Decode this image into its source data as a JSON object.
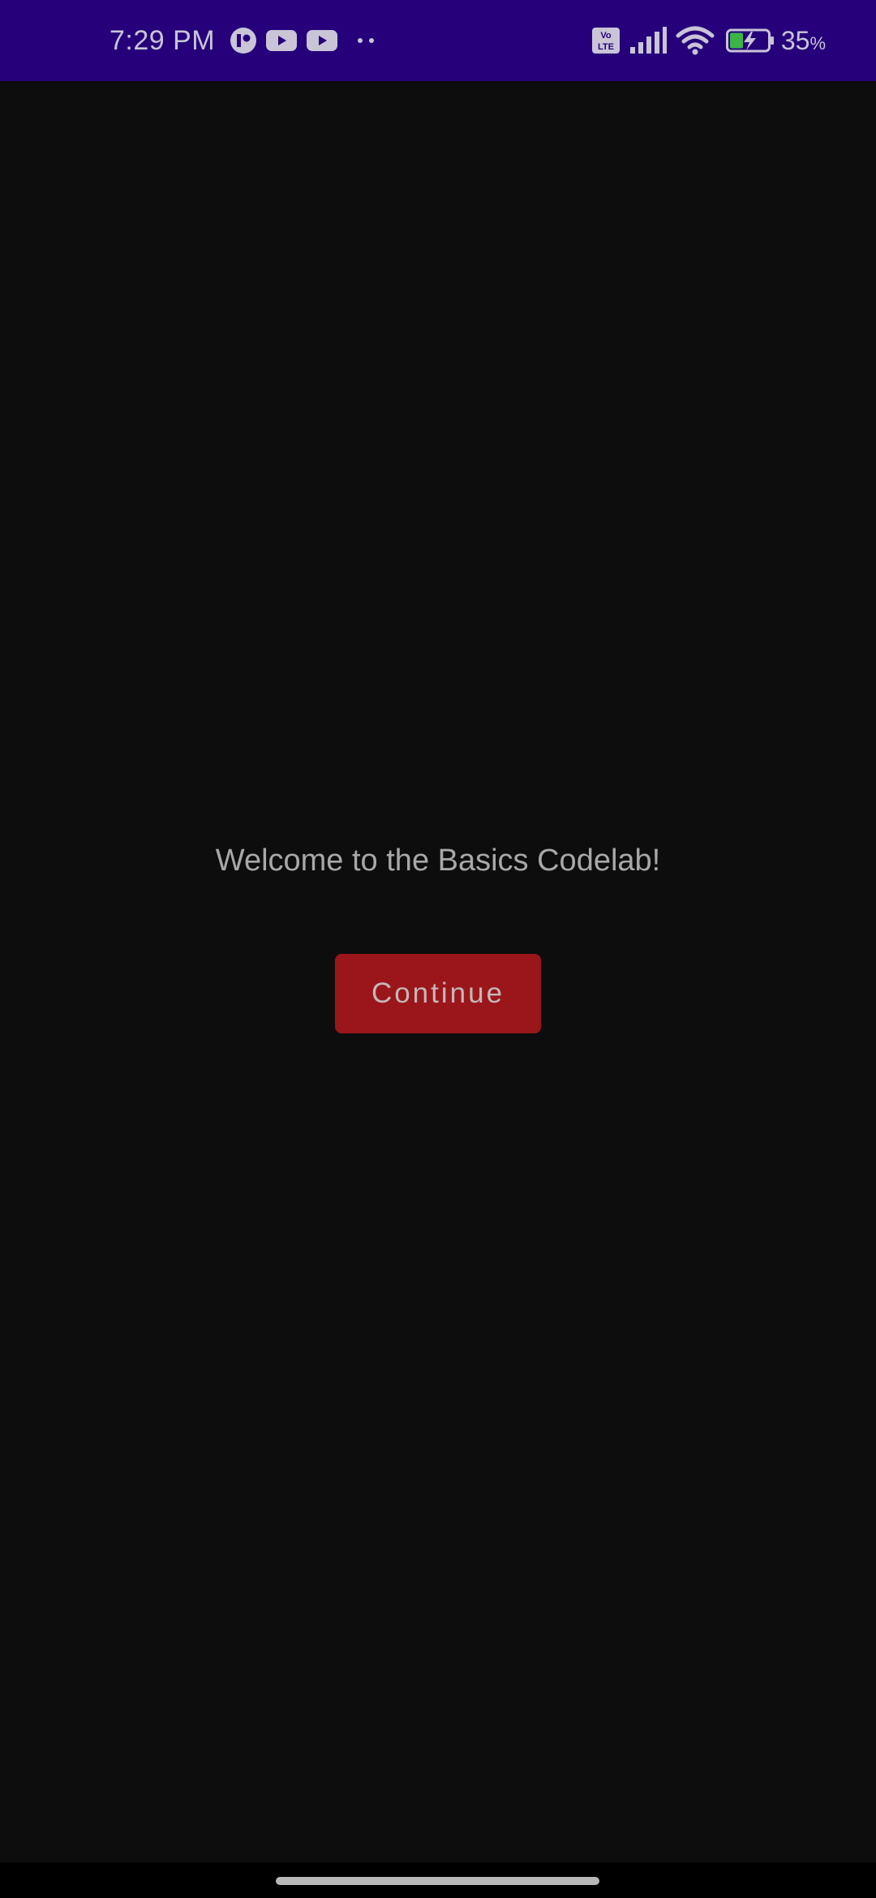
{
  "status_bar": {
    "time": "7:29 PM",
    "battery_percent": "35",
    "battery_unit": "%",
    "volte_line1": "Vo",
    "volte_line2": "LTE",
    "notification_icons": [
      "app-notification-icon",
      "youtube-icon",
      "youtube-icon",
      "more-notifications-icon"
    ],
    "system_icons": [
      "volte-icon",
      "signal-icon",
      "wifi-icon",
      "battery-charging-icon"
    ]
  },
  "main": {
    "welcome_text": "Welcome to the Basics Codelab!",
    "continue_label": "Continue"
  },
  "colors": {
    "status_bar_bg": "#25007a",
    "background": "#0d0d0d",
    "button_bg": "#9b161a",
    "text": "#a8a8a8",
    "battery_fill": "#3bb54a"
  }
}
